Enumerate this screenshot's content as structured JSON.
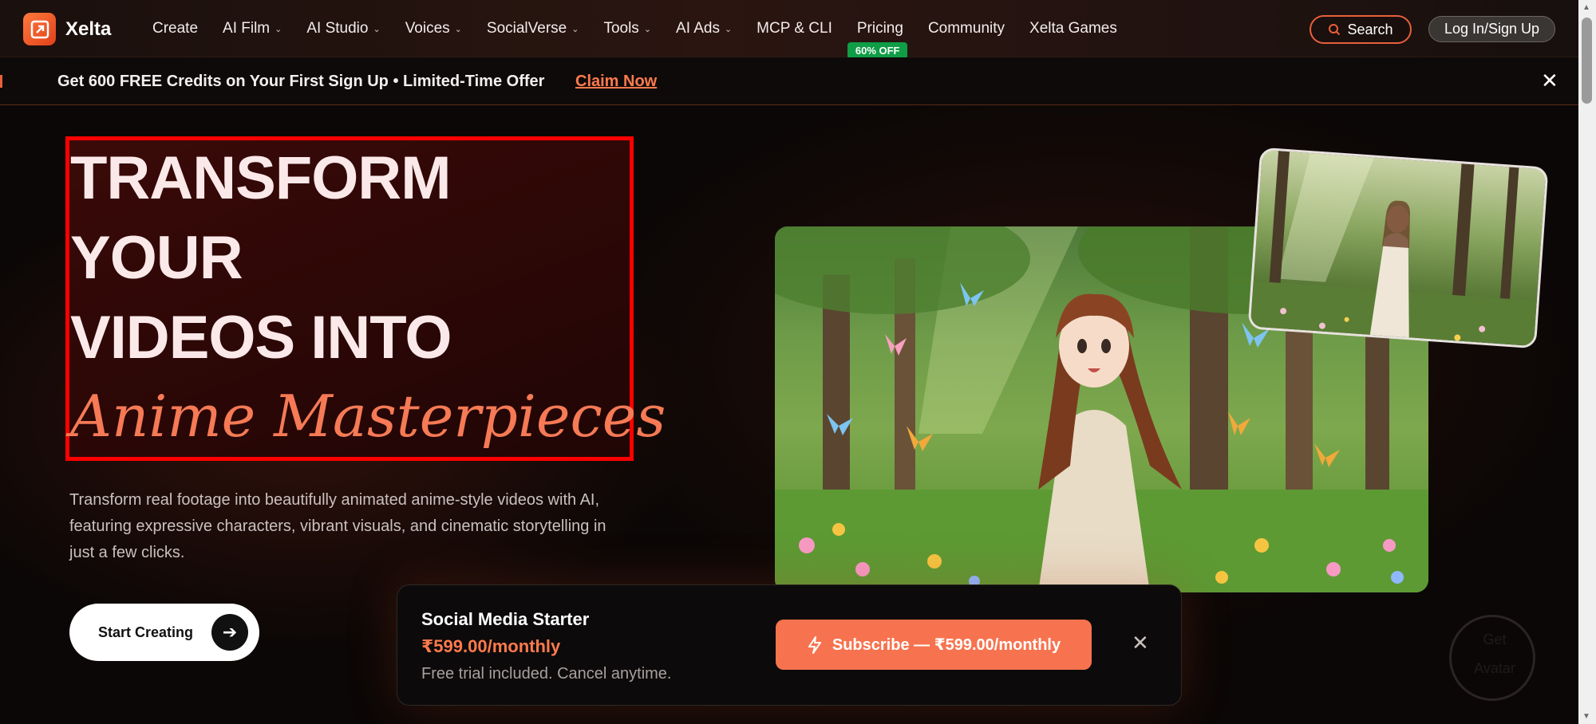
{
  "brand": {
    "name": "Xelta"
  },
  "nav": {
    "items": [
      {
        "label": "Create",
        "dropdown": false
      },
      {
        "label": "AI Film",
        "dropdown": true
      },
      {
        "label": "AI Studio",
        "dropdown": true
      },
      {
        "label": "Voices",
        "dropdown": true
      },
      {
        "label": "SocialVerse",
        "dropdown": true
      },
      {
        "label": "Tools",
        "dropdown": true
      },
      {
        "label": "AI Ads",
        "dropdown": true
      },
      {
        "label": "MCP & CLI",
        "dropdown": false
      },
      {
        "label": "Pricing",
        "dropdown": false,
        "badge": "60% OFF"
      },
      {
        "label": "Community",
        "dropdown": false
      },
      {
        "label": "Xelta Games",
        "dropdown": false
      }
    ],
    "search_label": "Search",
    "login_label": "Log In/Sign Up"
  },
  "promo": {
    "text": "Get 600 FREE Credits on Your First Sign Up • Limited-Time Offer",
    "link": "Claim Now",
    "close_icon": "close-icon"
  },
  "hero": {
    "line1": "TRANSFORM",
    "line2": "YOUR",
    "line3": "VIDEOS INTO",
    "accent": "Anime Masterpieces",
    "description": "Transform real footage into beautifully animated anime-style videos with AI, featuring expressive characters, vibrant visuals, and cinematic storytelling in just a few clicks.",
    "cta_label": "Start Creating"
  },
  "subscribe": {
    "plan": "Social Media Starter",
    "price": "₹599.00/monthly",
    "note": "Free trial included. Cancel anytime.",
    "button_label": "Subscribe — ₹599.00/monthly"
  },
  "ghost_widget": {
    "text": "Get Avatar"
  },
  "colors": {
    "accent": "#f7734f",
    "badge_green": "#0f9d46",
    "highlight_border": "#ff0000"
  }
}
